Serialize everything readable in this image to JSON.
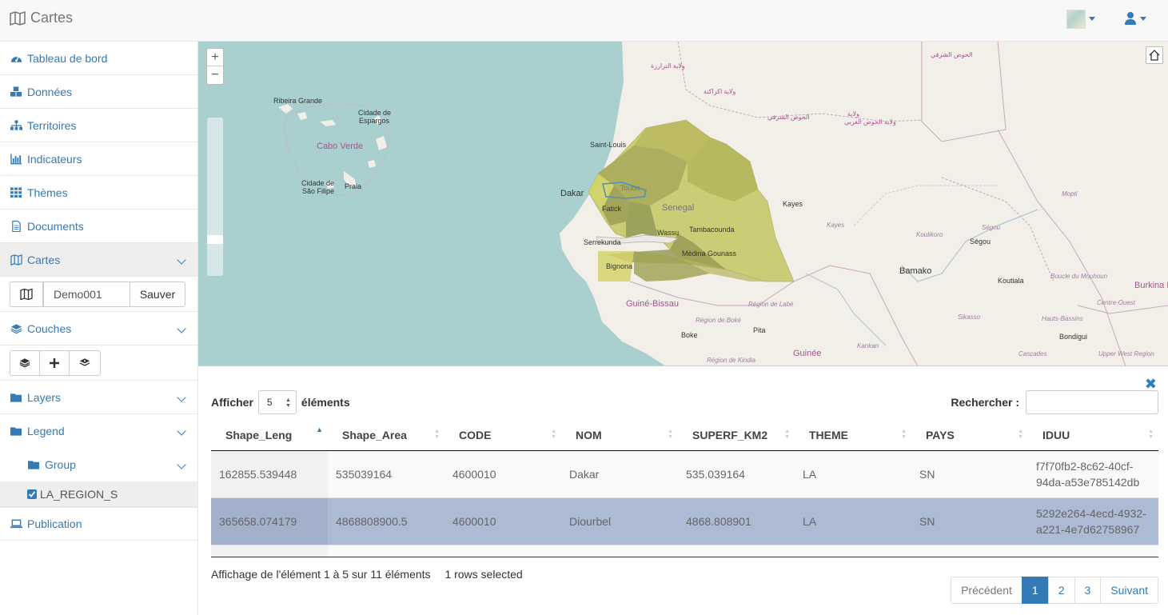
{
  "app": {
    "title": "Cartes"
  },
  "sidebar": {
    "items": [
      {
        "label": "Tableau de bord"
      },
      {
        "label": "Données"
      },
      {
        "label": "Territoires"
      },
      {
        "label": "Indicateurs"
      },
      {
        "label": "Thèmes"
      },
      {
        "label": "Documents"
      },
      {
        "label": "Cartes"
      }
    ],
    "map_name_value": "Demo001",
    "save_label": "Sauver",
    "couches_label": "Couches",
    "layers_label": "Layers",
    "legend_label": "Legend",
    "group_label": "Group",
    "layer_item_label": "LA_REGION_S",
    "publication_label": "Publication"
  },
  "map": {
    "zoom_in": "+",
    "zoom_out": "−",
    "labels": {
      "ribeira": "Ribeira Grande",
      "espargos1": "Cidade de",
      "espargos2": "Espargos",
      "caboverde": "Cabo Verde",
      "saofilipe1": "Cidade de",
      "saofilipe2": "São Filipe",
      "praia": "Praia",
      "saintlouis": "Saint-Louis",
      "dakar": "Dakar",
      "touba": "Touba",
      "fatick": "Fatick",
      "senegal": "Senegal",
      "tambacounda": "Tambacounda",
      "serrekunda": "Serrekunda",
      "wassu": "Wassu",
      "medina": "Médina Gounass",
      "bignona": "Bignona",
      "guineebissau": "Guiné-Bissau",
      "labe": "Région de Labé",
      "boke_region": "Région de Boké",
      "boke": "Boke",
      "pita": "Pita",
      "guinee": "Guinée",
      "kindia": "Région de Kindia",
      "kankan": "Kankan",
      "kayes": "Kayes",
      "kayes_region": "Kayes",
      "koulikoro": "Koulikoro",
      "segou": "Ségou",
      "segou_region": "Ségou",
      "bamako": "Bamako",
      "koutiala": "Koutiala",
      "mopti": "Mopti",
      "boucle": "Boucle du Mouhoun",
      "burkina": "Burkina Faso",
      "centreouest": "Centre-Ouest",
      "sikasso": "Sikasso",
      "hautsbassins": "Hauts-Bassins",
      "bondigui": "Bondigui",
      "cascades": "Cascades",
      "upperwest": "Upper West Region",
      "ar1": "ولاية الترارزة",
      "ar2": "ولاية اكراكنة",
      "ar3": "الحوض الشرقي",
      "ar4": "الحوض الشرقي",
      "ar5": "ولاية الحوض الغربي",
      "ar6": "ولاية"
    }
  },
  "table": {
    "length_prefix": "Afficher",
    "length_value": "5",
    "length_suffix": "éléments",
    "search_label": "Rechercher :",
    "columns": [
      "Shape_Leng",
      "Shape_Area",
      "CODE",
      "NOM",
      "SUPERF_KM2",
      "THEME",
      "PAYS",
      "IDUU"
    ],
    "rows": [
      [
        "162855.539448",
        "535039164",
        "4600010",
        "Dakar",
        "535.039164",
        "LA",
        "SN",
        "f7f70fb2-8c62-40cf-94da-a53e785142db"
      ],
      [
        "365658.074179",
        "4868808900.5",
        "4600010",
        "Diourbel",
        "4868.808901",
        "LA",
        "SN",
        "5292e264-4ecd-4932-a221-4e7d62758967"
      ]
    ],
    "info": "Affichage de l'élément 1 à 5 sur 11 éléments",
    "selected_info": "1 rows selected",
    "pager": {
      "prev": "Précédent",
      "pages": [
        "1",
        "2",
        "3"
      ],
      "next": "Suivant"
    }
  }
}
